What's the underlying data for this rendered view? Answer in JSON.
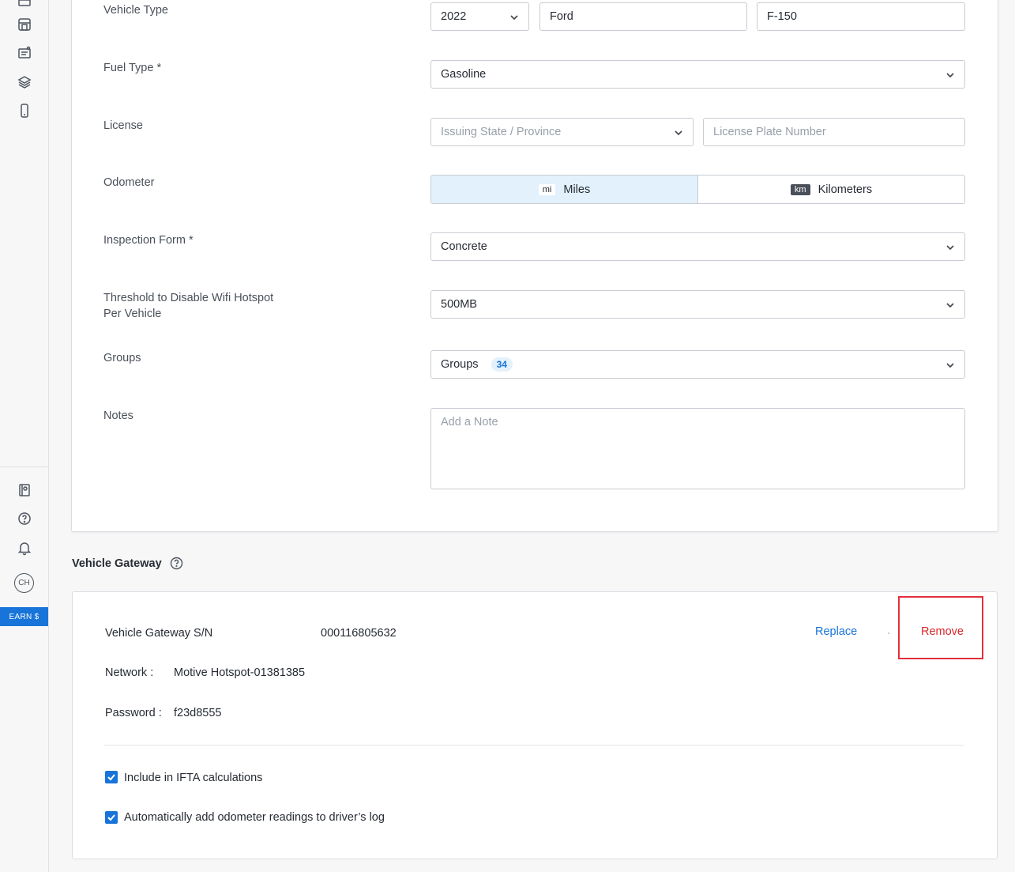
{
  "sidebar": {
    "avatar_initials": "CH",
    "earn_label": "EARN $"
  },
  "form": {
    "vehicle_type": {
      "label": "Vehicle Type",
      "year": "2022",
      "make": "Ford",
      "model": "F-150"
    },
    "fuel_type": {
      "label": "Fuel Type *",
      "value": "Gasoline"
    },
    "license": {
      "label": "License",
      "state_placeholder": "Issuing State / Province",
      "plate_placeholder": "License Plate Number"
    },
    "odometer": {
      "label": "Odometer",
      "miles_tag": "mi",
      "miles_label": "Miles",
      "km_tag": "km",
      "km_label": "Kilometers",
      "selected": "Miles"
    },
    "inspection_form": {
      "label": "Inspection Form *",
      "value": "Concrete"
    },
    "wifi_threshold": {
      "label_line1": "Threshold to Disable Wifi Hotspot",
      "label_line2": "Per Vehicle",
      "value": "500MB"
    },
    "groups": {
      "label": "Groups",
      "value": "Groups",
      "count": "34"
    },
    "notes": {
      "label": "Notes",
      "placeholder": "Add a Note"
    }
  },
  "gateway": {
    "section_title": "Vehicle Gateway",
    "sn_label": "Vehicle Gateway S/N",
    "sn_value": "000116805632",
    "replace_label": "Replace",
    "remove_label": "Remove",
    "network_label": "Network :",
    "network_value": "Motive Hotspot-01381385",
    "password_label": "Password :",
    "password_value": "f23d8555",
    "ifta_label": "Include in IFTA calculations",
    "ifta_checked": true,
    "odometer_log_label": "Automatically add odometer readings to driver’s log",
    "odometer_log_checked": true
  },
  "colors": {
    "accent": "#1874d9",
    "danger": "#d9262b",
    "highlight": "#e2303a"
  }
}
